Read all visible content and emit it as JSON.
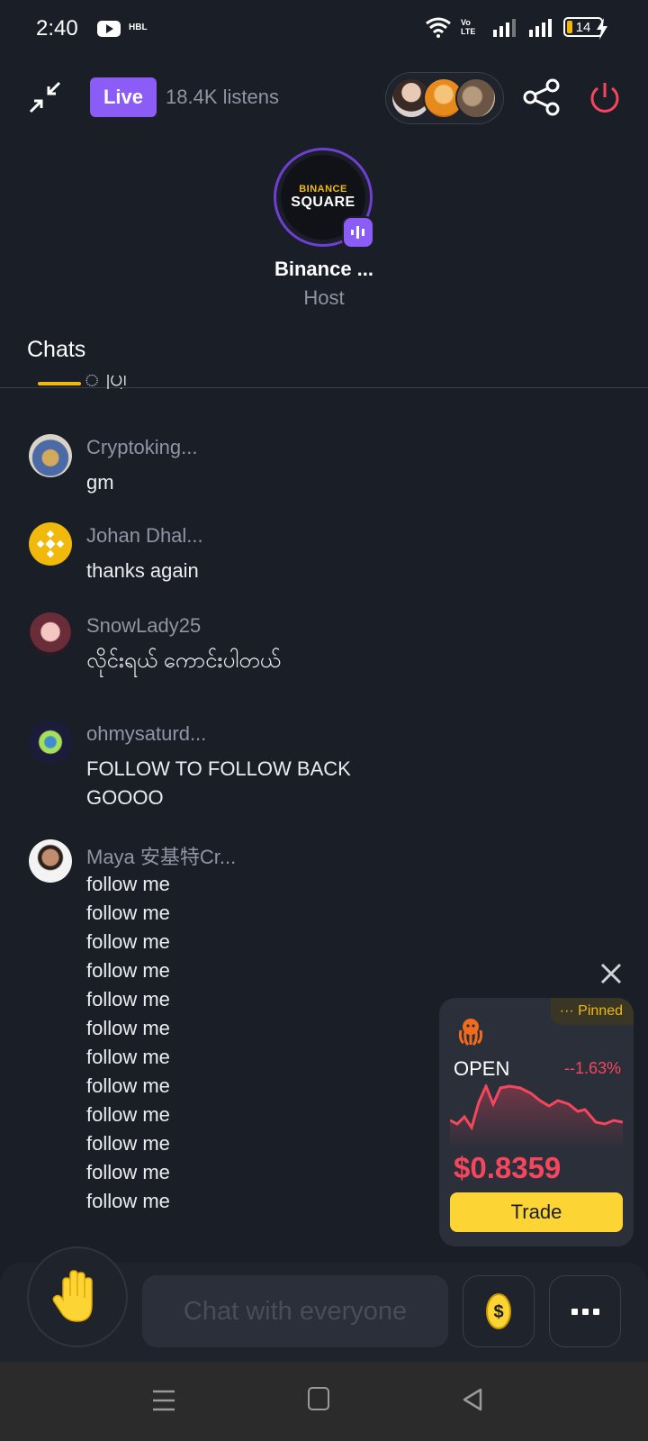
{
  "status_bar": {
    "time": "2:40",
    "carrier": "HBL",
    "volte": "Vo LTE",
    "battery": "14"
  },
  "top_bar": {
    "live_label": "Live",
    "listens": "18.4K listens"
  },
  "host": {
    "logo_line1": "BINANCE",
    "logo_line2": "SQUARE",
    "name": "Binance ...",
    "role": "Host"
  },
  "tabs": {
    "chats": "Chats"
  },
  "chats": [
    {
      "user": "Cryptoking...",
      "message": "gm"
    },
    {
      "user": "Johan Dhal...",
      "message": "thanks again"
    },
    {
      "user": "SnowLady25",
      "message": "လိုင်းရယ် ကောင်းပါတယ်"
    },
    {
      "user": "ohmysaturd...",
      "message_lines": [
        "FOLLOW TO FOLLOW BACK",
        "GOOOO"
      ]
    },
    {
      "user": "Maya 安基特Cr...",
      "message_lines": [
        "follow me",
        "follow me",
        "follow me",
        "follow me",
        "follow me",
        "follow me",
        "follow me",
        "follow me",
        "follow me",
        "follow me",
        "follow me",
        "follow me"
      ]
    }
  ],
  "pinned": {
    "tag": "Pinned",
    "token": "OPEN",
    "change": "--1.63%",
    "price": "$0.8359",
    "trade_label": "Trade"
  },
  "input": {
    "placeholder": "Chat with everyone"
  },
  "colors": {
    "background": "#1a1e27",
    "accent_live": "#8b5cf6",
    "binance_yellow": "#f0b90b",
    "negative": "#f6465d"
  }
}
